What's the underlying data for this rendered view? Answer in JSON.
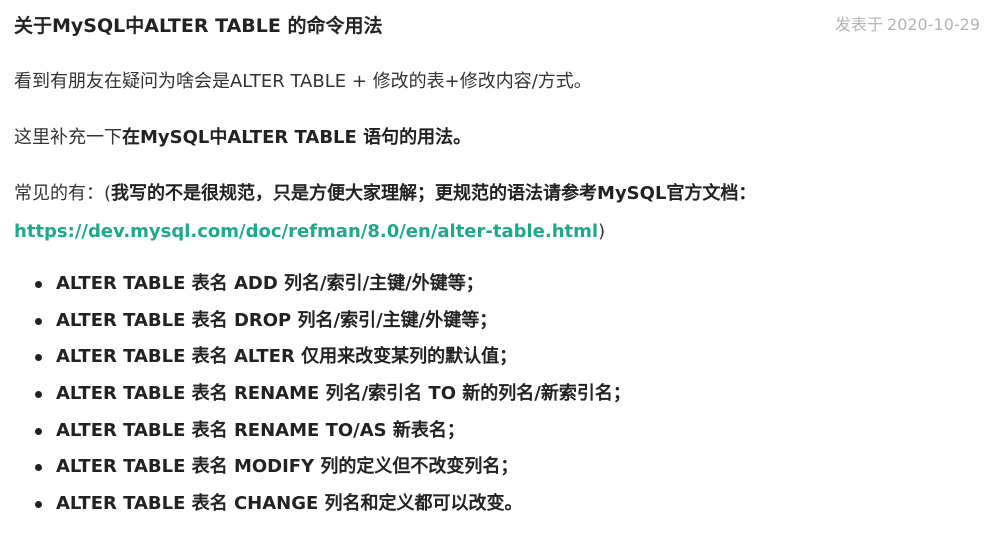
{
  "post": {
    "title": "关于MySQL中ALTER TABLE 的命令用法",
    "meta": {
      "posted_label": "发表于",
      "date": "2020-10-29"
    },
    "paragraph1": "看到有朋友在疑问为啥会是ALTER TABLE + 修改的表+修改内容/方式。",
    "paragraph2": {
      "plain": "这里补充一下",
      "bold": "在MySQL中ALTER TABLE 语句的用法。"
    },
    "paragraph3": {
      "plain": "常见的有：(",
      "bold": "我写的不是很规范，只是方便大家理解；更规范的语法请参考MySQL官方文档：",
      "link": "https://dev.mysql.com/doc/refman/8.0/en/alter-table.html",
      "close": ")"
    },
    "bullets": [
      "ALTER TABLE 表名 ADD 列名/索引/主键/外键等；",
      "ALTER TABLE 表名 DROP 列名/索引/主键/外键等；",
      "ALTER TABLE 表名 ALTER 仅用来改变某列的默认值；",
      "ALTER TABLE 表名 RENAME 列名/索引名 TO 新的列名/新索引名；",
      "ALTER TABLE 表名 RENAME TO/AS 新表名；",
      "ALTER TABLE 表名 MODIFY 列的定义但不改变列名；",
      "ALTER TABLE 表名 CHANGE 列名和定义都可以改变。"
    ],
    "colors": {
      "link": "#1ea88c",
      "meta": "#b4b4b4",
      "text": "#333333"
    }
  }
}
